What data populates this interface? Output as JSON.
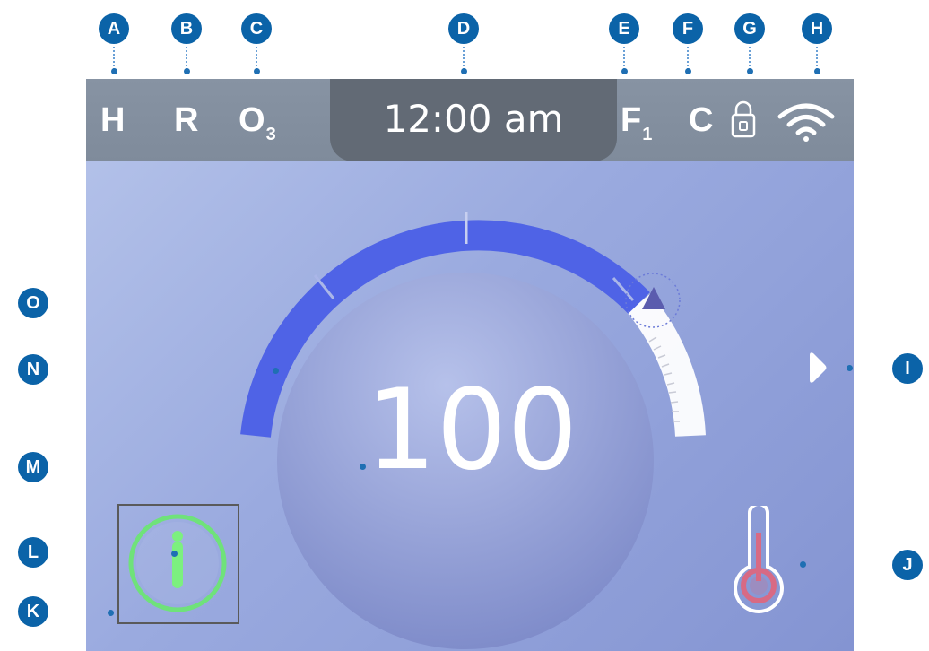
{
  "callouts": [
    "A",
    "B",
    "C",
    "D",
    "E",
    "F",
    "G",
    "H",
    "I",
    "J",
    "K",
    "L",
    "M",
    "N",
    "O"
  ],
  "status_bar": {
    "heater_indicator": "H",
    "r_indicator": "R",
    "ozone_indicator": "O",
    "ozone_subscript": "3",
    "clock": "12:00 am",
    "filter_indicator": "F",
    "filter_subscript": "1",
    "c_indicator": "C",
    "lock_icon": "lock-icon",
    "wifi_icon": "wifi-icon"
  },
  "main": {
    "set_temperature": "100",
    "gauge_icon": "gauge-arc",
    "next_icon": "chevron-right-icon",
    "thermometer_icon": "thermometer-icon",
    "info_icon": "info-icon"
  },
  "colors": {
    "callout": "#0b63a8",
    "gauge_fill": "#4f63e6",
    "info_ring": "#6fe27a",
    "thermometer": "#d86a84"
  }
}
